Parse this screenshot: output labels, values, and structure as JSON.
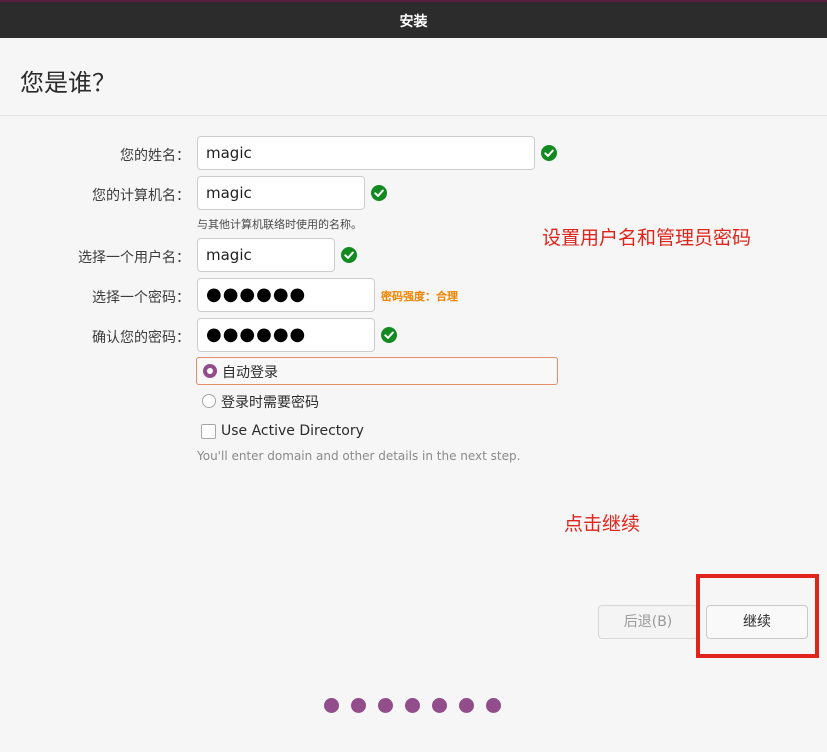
{
  "window": {
    "title": "安装"
  },
  "page": {
    "title": "您是谁？"
  },
  "form": {
    "name_label": "您的姓名：",
    "name_value": "magic",
    "computer_label": "您的计算机名：",
    "computer_value": "magic",
    "computer_hint": "与其他计算机联络时使用的名称。",
    "username_label": "选择一个用户名：",
    "username_value": "magic",
    "password_label": "选择一个密码：",
    "password_value": "●●●●●●",
    "password_strength": "密码强度：合理",
    "confirm_label": "确认您的密码：",
    "confirm_value": "●●●●●●",
    "login_options": [
      {
        "label": "自动登录",
        "selected": true
      },
      {
        "label": "登录时需要密码",
        "selected": false
      }
    ],
    "active_directory_label": "Use Active Directory",
    "active_directory_checked": false,
    "active_directory_note": "You'll enter domain and other details in the next step."
  },
  "annotations": {
    "setup_note": "设置用户名和管理员密码",
    "continue_note": "点击继续"
  },
  "buttons": {
    "back_label": "后退(B)",
    "continue_label": "继续"
  },
  "progress": {
    "steps_total": 7
  },
  "colors": {
    "accent": "#924d8b",
    "check": "#128a21",
    "strength": "#f08400",
    "annotation": "#e0241b",
    "titlebar": "#2c2c2c"
  },
  "icons": {
    "valid": "check-circle-icon"
  }
}
